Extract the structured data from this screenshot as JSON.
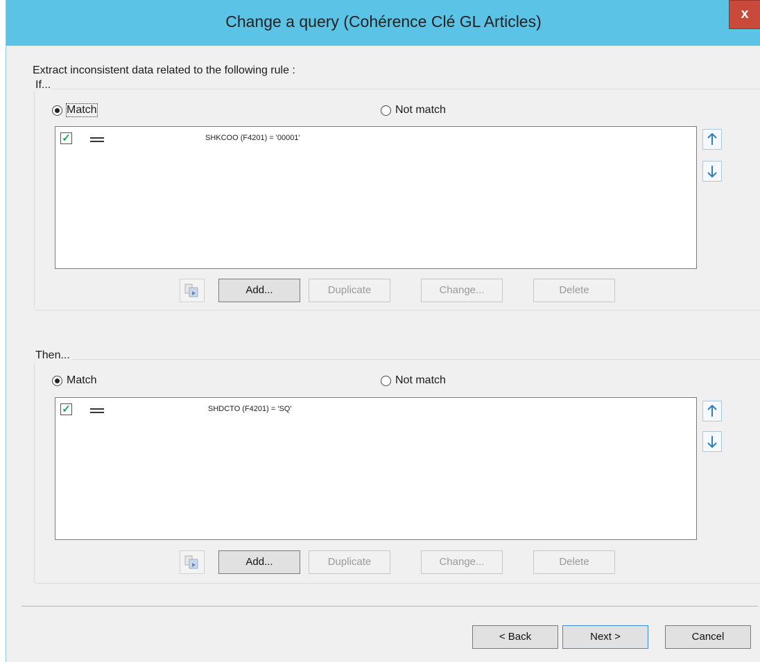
{
  "window": {
    "title": "Change a query (Cohérence Clé GL Articles)",
    "close_label": "x"
  },
  "intro": "Extract inconsistent data related to the following rule :",
  "if_group": {
    "label": "If...",
    "match_label": "Match",
    "not_match_label": "Not match",
    "selected": "Match",
    "conditions": [
      {
        "checked": true,
        "operator_icon": "equals-icon",
        "text": "SHKCOO (F4201) = '00001'"
      }
    ],
    "buttons": {
      "add": "Add...",
      "duplicate": "Duplicate",
      "change": "Change...",
      "delete": "Delete"
    }
  },
  "then_group": {
    "label": "Then...",
    "match_label": "Match",
    "not_match_label": "Not match",
    "selected": "Match",
    "conditions": [
      {
        "checked": true,
        "operator_icon": "equals-icon",
        "text": "SHDCTO (F4201) = 'SQ'"
      }
    ],
    "buttons": {
      "add": "Add...",
      "duplicate": "Duplicate",
      "change": "Change...",
      "delete": "Delete"
    }
  },
  "footer": {
    "back": "< Back",
    "next": "Next >",
    "cancel": "Cancel"
  },
  "colors": {
    "titlebar": "#5bc3e6",
    "close": "#c94a3a",
    "check": "#1fa35a"
  }
}
